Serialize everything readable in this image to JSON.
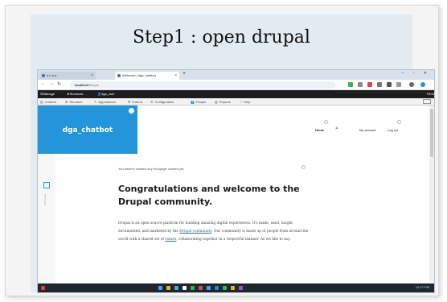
{
  "slide": {
    "title": "Step1 : open drupal"
  },
  "browser": {
    "tabs": [
      {
        "label": "n n d a"
      },
      {
        "label": "Welcome | dga_chatbot"
      }
    ],
    "new_tab": "+",
    "window_controls": "– ▫ ✕",
    "address": {
      "host": "localhost",
      "path": "/drupal"
    },
    "nav": {
      "back": "←",
      "forward": "→",
      "reload": "↻"
    }
  },
  "admin_toolbar": {
    "manage": "Manage",
    "shortcuts": "Shortcuts",
    "user": "dga_user",
    "edit": "Edit"
  },
  "admin_menu": {
    "items": [
      {
        "label": "Content",
        "icon": "content-icon"
      },
      {
        "label": "Structure",
        "icon": "structure-icon"
      },
      {
        "label": "Appearance",
        "icon": "appearance-icon"
      },
      {
        "label": "Extend",
        "icon": "extend-icon"
      },
      {
        "label": "Configuration",
        "icon": "configuration-icon"
      },
      {
        "label": "People",
        "icon": "people-icon"
      },
      {
        "label": "Reports",
        "icon": "reports-icon"
      },
      {
        "label": "Help",
        "icon": "help-icon"
      }
    ]
  },
  "site": {
    "name": "dga_chatbot",
    "nav": {
      "home": "Home",
      "account": "My account",
      "logout": "Log out"
    },
    "rail_label": "Edit mode"
  },
  "content": {
    "note": "You haven't created any frontpage content yet.",
    "heading": "Congratulations and welcome to the Drupal community.",
    "para_1": "Drupal is an open source platform for building amazing digital experiences. It's made, used, taught, documented, and marketed by the ",
    "link_community": "Drupal community",
    "para_2": ". Our community is made up of people from around the world with a shared set of ",
    "link_values": "values",
    "para_3": ", collaborating together in a respectful manner. As we like to say:"
  },
  "taskbar": {
    "clock": "12:27 PM"
  },
  "colors": {
    "brand": "#2494db",
    "toolbar": "#1d1d1d",
    "slide_bg": "#e2eaf2"
  }
}
